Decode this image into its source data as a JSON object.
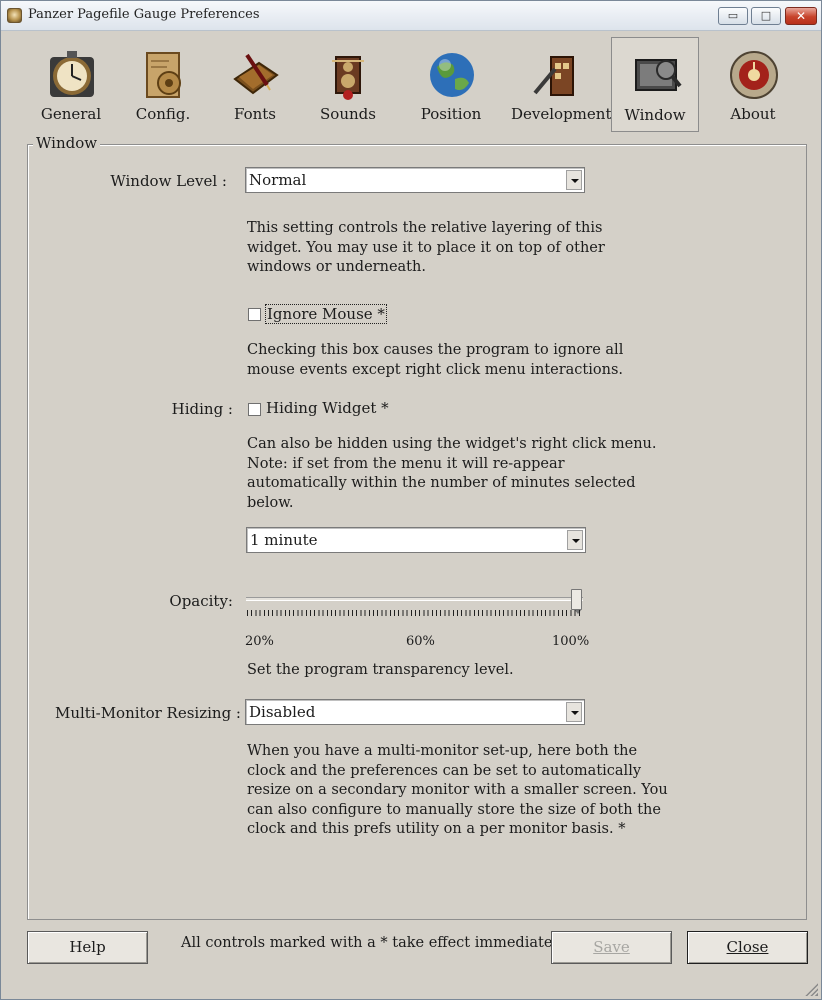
{
  "window": {
    "title": "Panzer Pagefile Gauge Preferences",
    "controls": {
      "minimize": "▭",
      "maximize": "□",
      "close": "✕"
    }
  },
  "toolbar": {
    "tabs": [
      {
        "label": "General",
        "icon": "clock-gauge-icon"
      },
      {
        "label": "Config.",
        "icon": "config-scroll-icon"
      },
      {
        "label": "Fonts",
        "icon": "book-pen-icon"
      },
      {
        "label": "Sounds",
        "icon": "speaker-machine-icon"
      },
      {
        "label": "Position",
        "icon": "globe-icon"
      },
      {
        "label": "Development",
        "icon": "development-machine-icon"
      },
      {
        "label": "Window",
        "icon": "window-monitor-icon",
        "active": true
      },
      {
        "label": "About",
        "icon": "about-dial-icon"
      }
    ]
  },
  "panel": {
    "legend": "Window",
    "window_level": {
      "label": "Window Level :",
      "value": "Normal",
      "description": [
        "This setting controls the relative layering of this",
        "widget. You may use it to place it on top of other",
        "windows or underneath."
      ]
    },
    "ignore_mouse": {
      "label": "Ignore Mouse *",
      "checked": false,
      "description": [
        "Checking this box causes the program to ignore all",
        "mouse events except right click menu interactions."
      ]
    },
    "hiding": {
      "label": "Hiding :",
      "checkbox_label": "Hiding Widget *",
      "checked": false,
      "description": [
        "Can also be hidden using the widget's right click menu.",
        "Note: if set from the menu it will re-appear",
        "automatically within the number of minutes selected",
        "below."
      ],
      "duration": "1 minute"
    },
    "opacity": {
      "label": "Opacity:",
      "value_percent": 100,
      "ticks": [
        "20%",
        "60%",
        "100%"
      ],
      "description": "Set the program transparency level."
    },
    "multi_monitor": {
      "label": "Multi-Monitor Resizing :",
      "value": "Disabled",
      "description": [
        "When you have a multi-monitor set-up, here both the",
        "clock and the preferences can be set to automatically",
        "resize on a secondary monitor with a smaller screen. You",
        "can also configure to manually store the size of both the",
        "clock and this prefs utility on a per monitor basis. *"
      ]
    }
  },
  "footer": {
    "help": "Help",
    "note": "All controls marked with a * take effect immediately.",
    "save": "Save",
    "close": "Close"
  }
}
